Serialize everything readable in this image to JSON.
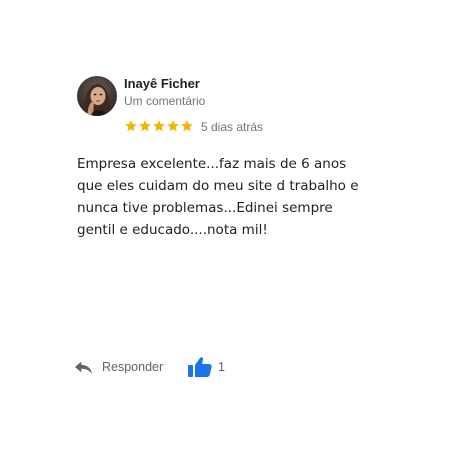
{
  "review": {
    "author_name": "Inayê Ficher",
    "review_count": "Um comentário",
    "rating": 5,
    "rating_max": 5,
    "date": "5 dias atrás",
    "text": "Empresa excelente...faz mais de 6 anos\nque eles cuidam do meu site d trabalho e\nnunca tive problemas...Edinei sempre\ngentil e educado....nota mil!"
  },
  "actions": {
    "reply_label": "Responder",
    "like_count": "1"
  },
  "icons": {
    "avatar": "avatar-photo",
    "star": "star-icon",
    "reply": "reply-arrow-icon",
    "like": "thumbs-up-icon"
  },
  "colors": {
    "star": "#f4b400",
    "like": "#1a73e8",
    "secondary_text": "#70757a",
    "action_text": "#5f6368"
  }
}
